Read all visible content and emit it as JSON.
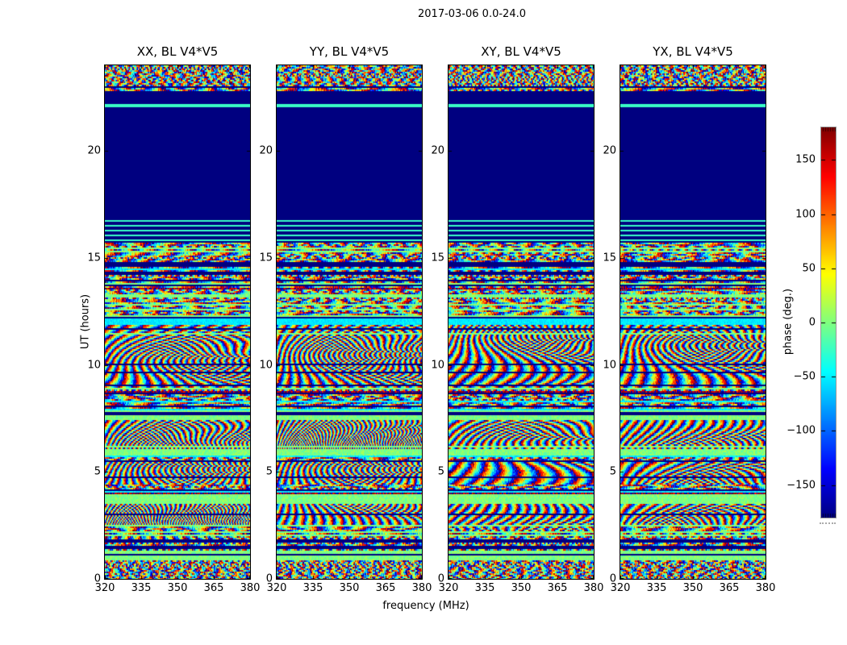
{
  "title": "2017-03-06 0.0-24.0",
  "panels": [
    {
      "title": "XX, BL V4*V5"
    },
    {
      "title": "YY, BL V4*V5"
    },
    {
      "title": "XY, BL V4*V5"
    },
    {
      "title": "YX, BL V4*V5"
    }
  ],
  "axis": {
    "xlabel": "frequency (MHz)",
    "ylabel": "UT (hours)"
  },
  "colorbar": {
    "label": "phase (deg.)",
    "ticks": [
      150,
      100,
      50,
      0,
      -50,
      -100,
      -150
    ],
    "vmin": -180,
    "vmax": 180,
    "colormap": "jet"
  },
  "chart_data": {
    "type": "heatmap",
    "title": "2017-03-06 0.0-24.0",
    "subplot_titles": [
      "XX, BL V4*V5",
      "YY, BL V4*V5",
      "XY, BL V4*V5",
      "YX, BL V4*V5"
    ],
    "xlabel": "frequency (MHz)",
    "ylabel": "UT (hours)",
    "xlim": [
      320,
      380
    ],
    "x_ticks": [
      320,
      335,
      350,
      365,
      380
    ],
    "ylim": [
      0,
      24
    ],
    "y_ticks": [
      0,
      5,
      10,
      15,
      20
    ],
    "grid": false,
    "colormap": "jet",
    "value_label": "phase (deg.)",
    "value_range": [
      -180,
      180
    ],
    "colorbar_ticks": [
      150,
      100,
      50,
      0,
      -50,
      -100,
      -150
    ],
    "legend_position": "right-colorbar",
    "bands": [
      {
        "t0": 23.05,
        "t1": 24.0,
        "pattern": "noise"
      },
      {
        "t0": 22.78,
        "t1": 23.05,
        "pattern": "stripes"
      },
      {
        "t0": 22.18,
        "t1": 22.78,
        "pattern": "blank"
      },
      {
        "t0": 22.06,
        "t1": 22.18,
        "pattern": "line"
      },
      {
        "t0": 16.8,
        "t1": 22.06,
        "pattern": "blank"
      },
      {
        "t0": 15.7,
        "t1": 16.8,
        "pattern": "lines"
      },
      {
        "t0": 12.15,
        "t1": 15.7,
        "pattern": "stripes"
      },
      {
        "t0": 11.9,
        "t1": 12.15,
        "pattern": "cyan"
      },
      {
        "t0": 8.95,
        "t1": 11.9,
        "pattern": "fringes"
      },
      {
        "t0": 7.85,
        "t1": 8.95,
        "pattern": "stripes"
      },
      {
        "t0": 7.4,
        "t1": 7.85,
        "pattern": "green"
      },
      {
        "t0": 6.1,
        "t1": 7.4,
        "pattern": "fringes"
      },
      {
        "t0": 5.75,
        "t1": 6.1,
        "pattern": "green"
      },
      {
        "t0": 5.5,
        "t1": 5.75,
        "pattern": "stripes"
      },
      {
        "t0": 4.4,
        "t1": 5.5,
        "pattern": "fringes"
      },
      {
        "t0": 3.95,
        "t1": 4.4,
        "pattern": "stripes"
      },
      {
        "t0": 3.5,
        "t1": 3.95,
        "pattern": "green"
      },
      {
        "t0": 2.55,
        "t1": 3.5,
        "pattern": "fringes"
      },
      {
        "t0": 1.35,
        "t1": 2.55,
        "pattern": "stripes"
      },
      {
        "t0": 0.9,
        "t1": 1.35,
        "pattern": "green"
      },
      {
        "t0": 0.0,
        "t1": 0.9,
        "pattern": "noise"
      }
    ]
  }
}
